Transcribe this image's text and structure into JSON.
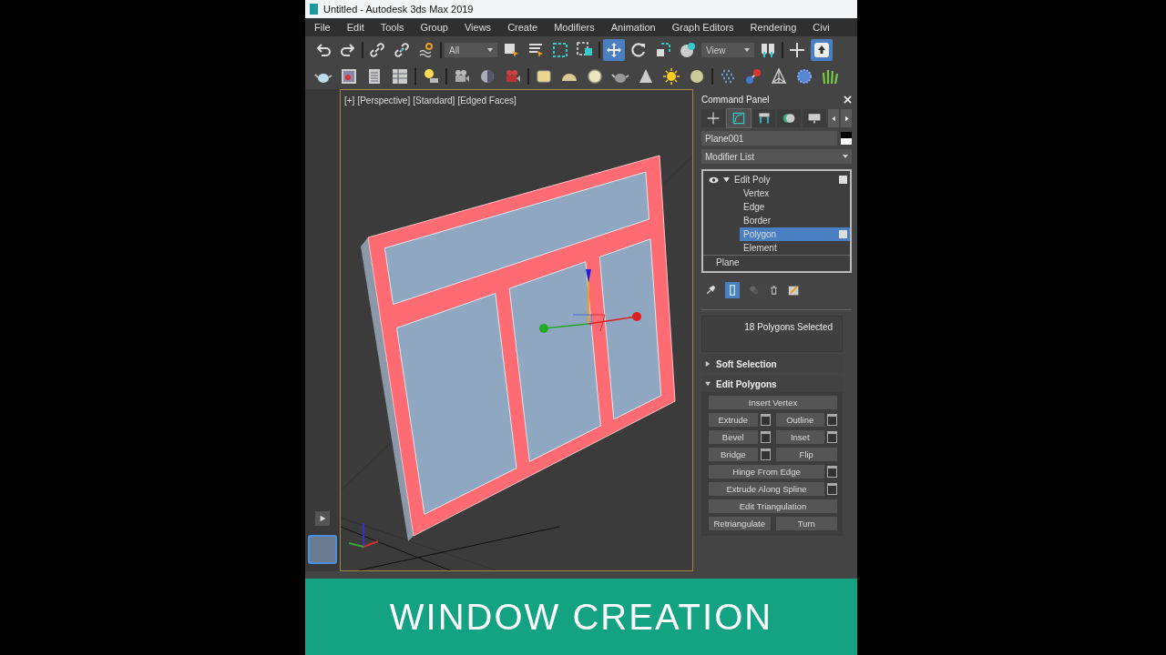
{
  "window": {
    "title": "Untitled - Autodesk 3ds Max 2019"
  },
  "menu": [
    "File",
    "Edit",
    "Tools",
    "Group",
    "Views",
    "Create",
    "Modifiers",
    "Animation",
    "Graph Editors",
    "Rendering",
    "Civi"
  ],
  "toolbar": {
    "selection_filter": "All",
    "reference_coordinates": "View"
  },
  "viewport": {
    "labels": [
      "[+]",
      "[Perspective]",
      "[Standard]",
      "[Edged Faces]"
    ]
  },
  "command_panel": {
    "title": "Command Panel",
    "tabs": [
      {
        "kind": "create",
        "selected": false
      },
      {
        "kind": "modify",
        "selected": true
      },
      {
        "kind": "hierarchy",
        "selected": false
      },
      {
        "kind": "motion",
        "selected": false
      },
      {
        "kind": "display",
        "selected": false
      }
    ],
    "object_name": "Plane001",
    "modifier_list": "Modifier List",
    "stack": [
      {
        "label": "Edit Poly",
        "expanded": true,
        "children": [
          {
            "label": "Vertex",
            "selected": false
          },
          {
            "label": "Edge",
            "selected": false
          },
          {
            "label": "Border",
            "selected": false
          },
          {
            "label": "Polygon",
            "selected": true
          },
          {
            "label": "Element",
            "selected": false
          }
        ]
      },
      {
        "label": "Plane"
      }
    ],
    "selection_info": "18 Polygons Selected",
    "rollouts": [
      {
        "title": "Soft Selection",
        "expanded": false
      },
      {
        "title": "Edit Polygons",
        "expanded": true,
        "rows": [
          [
            {
              "label": "Insert Vertex",
              "settings": false
            }
          ],
          [
            {
              "label": "Extrude",
              "settings": true
            },
            {
              "label": "Outline",
              "settings": true
            }
          ],
          [
            {
              "label": "Bevel",
              "settings": true
            },
            {
              "label": "Inset",
              "settings": true
            }
          ],
          [
            {
              "label": "Bridge",
              "settings": true
            },
            {
              "label": "Flip",
              "settings": false
            }
          ],
          [
            {
              "label": "Hinge From Edge",
              "settings": true
            }
          ],
          [
            {
              "label": "Extrude Along Spline",
              "settings": true
            }
          ],
          [
            {
              "label": "Edit Triangulation",
              "settings": false
            }
          ],
          [
            {
              "label": "Retriangulate",
              "settings": false
            },
            {
              "label": "Turn",
              "settings": false
            }
          ]
        ]
      }
    ]
  },
  "banner": {
    "text": "WINDOW CREATION"
  }
}
